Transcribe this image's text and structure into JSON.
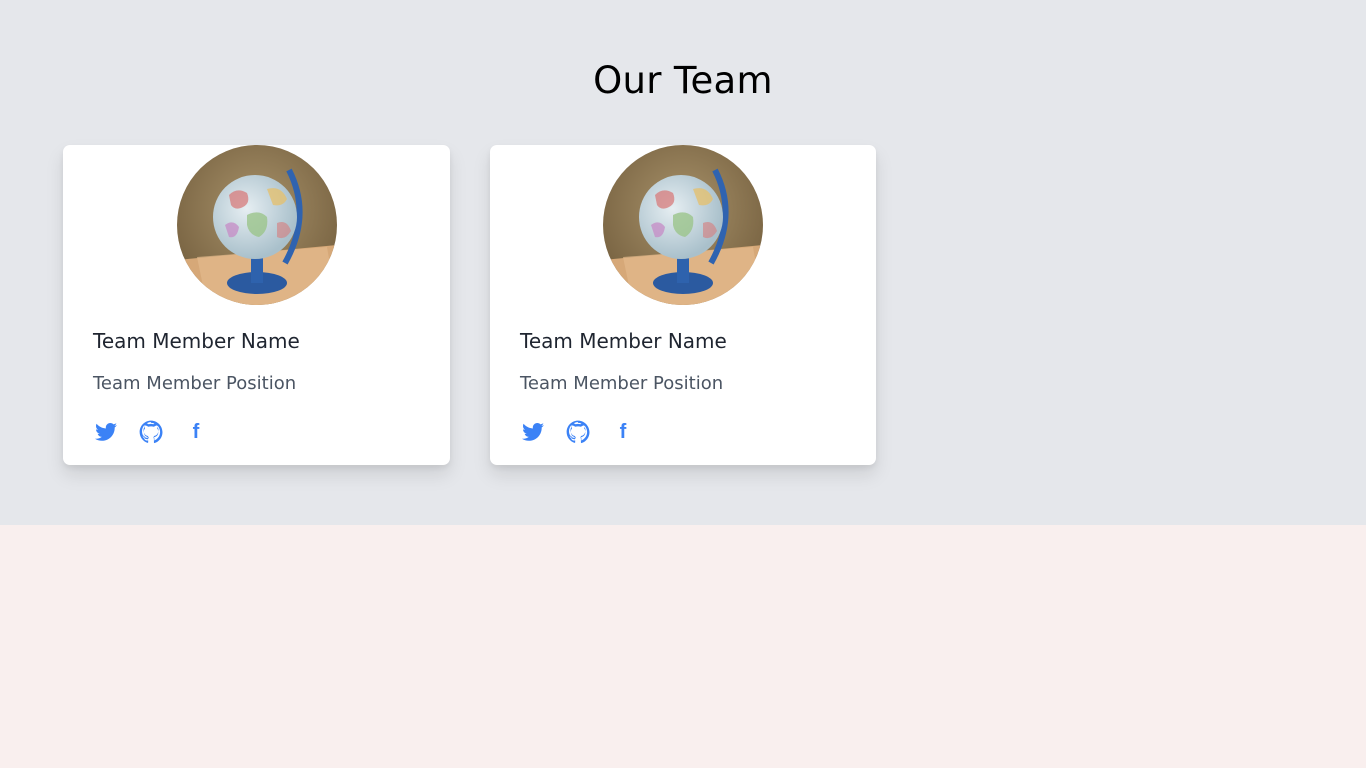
{
  "section": {
    "title": "Our Team"
  },
  "colors": {
    "section_bg": "#e5e7eb",
    "page_bg": "#f9efee",
    "card_bg": "#ffffff",
    "icon_accent": "#3b82f6"
  },
  "members": [
    {
      "name": "Team Member Name",
      "position": "Team Member Position",
      "photo_icon": "globe-photo",
      "socials": [
        {
          "icon": "twitter-icon"
        },
        {
          "icon": "github-icon"
        },
        {
          "icon": "facebook-icon",
          "glyph": "f"
        }
      ]
    },
    {
      "name": "Team Member Name",
      "position": "Team Member Position",
      "photo_icon": "globe-photo",
      "socials": [
        {
          "icon": "twitter-icon"
        },
        {
          "icon": "github-icon"
        },
        {
          "icon": "facebook-icon",
          "glyph": "f"
        }
      ]
    }
  ]
}
